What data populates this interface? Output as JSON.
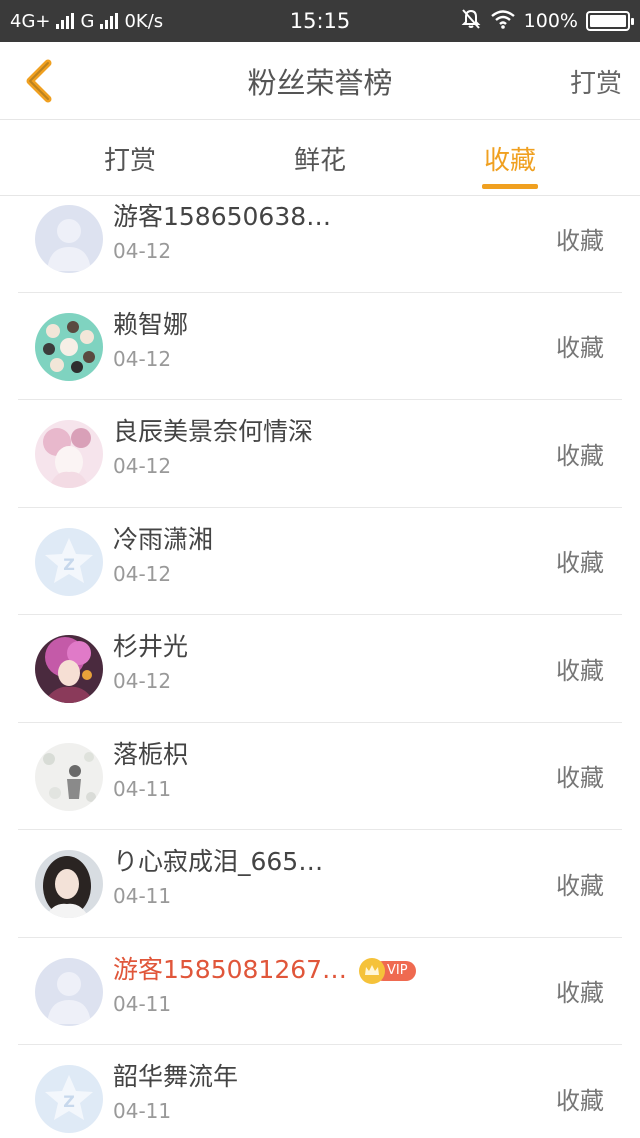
{
  "status_bar": {
    "network1": "4G+",
    "network2": "G",
    "speed": "0K/s",
    "time": "15:15",
    "battery": "100%",
    "battery_level": 1.0
  },
  "header": {
    "title": "粉丝荣誉榜",
    "action": "打赏"
  },
  "tabs": [
    {
      "label": "打赏",
      "active": false
    },
    {
      "label": "鲜花",
      "active": false
    },
    {
      "label": "收藏",
      "active": true
    }
  ],
  "colors": {
    "accent": "#f0a020",
    "vip_name": "#e0563a",
    "status_bar": "#3a3a3a"
  },
  "fans": [
    {
      "name": "游客158650638…",
      "date": "04-12",
      "action": "收藏",
      "avatar": "default-user"
    },
    {
      "name": "赖智娜",
      "date": "04-12",
      "action": "收藏",
      "avatar": "photo-green"
    },
    {
      "name": "良辰美景奈何情深",
      "date": "04-12",
      "action": "收藏",
      "avatar": "photo-pink"
    },
    {
      "name": "冷雨潇湘",
      "date": "04-12",
      "action": "收藏",
      "avatar": "default-star"
    },
    {
      "name": "杉井光",
      "date": "04-12",
      "action": "收藏",
      "avatar": "photo-purple"
    },
    {
      "name": "落栀枳",
      "date": "04-11",
      "action": "收藏",
      "avatar": "photo-sketch"
    },
    {
      "name": "り心寂成泪_665…",
      "date": "04-11",
      "action": "收藏",
      "avatar": "photo-girl"
    },
    {
      "name": "游客1585081267…",
      "date": "04-11",
      "action": "收藏",
      "avatar": "default-user",
      "vip": "VIP"
    },
    {
      "name": "韶华舞流年",
      "date": "04-11",
      "action": "收藏",
      "avatar": "default-star"
    }
  ]
}
